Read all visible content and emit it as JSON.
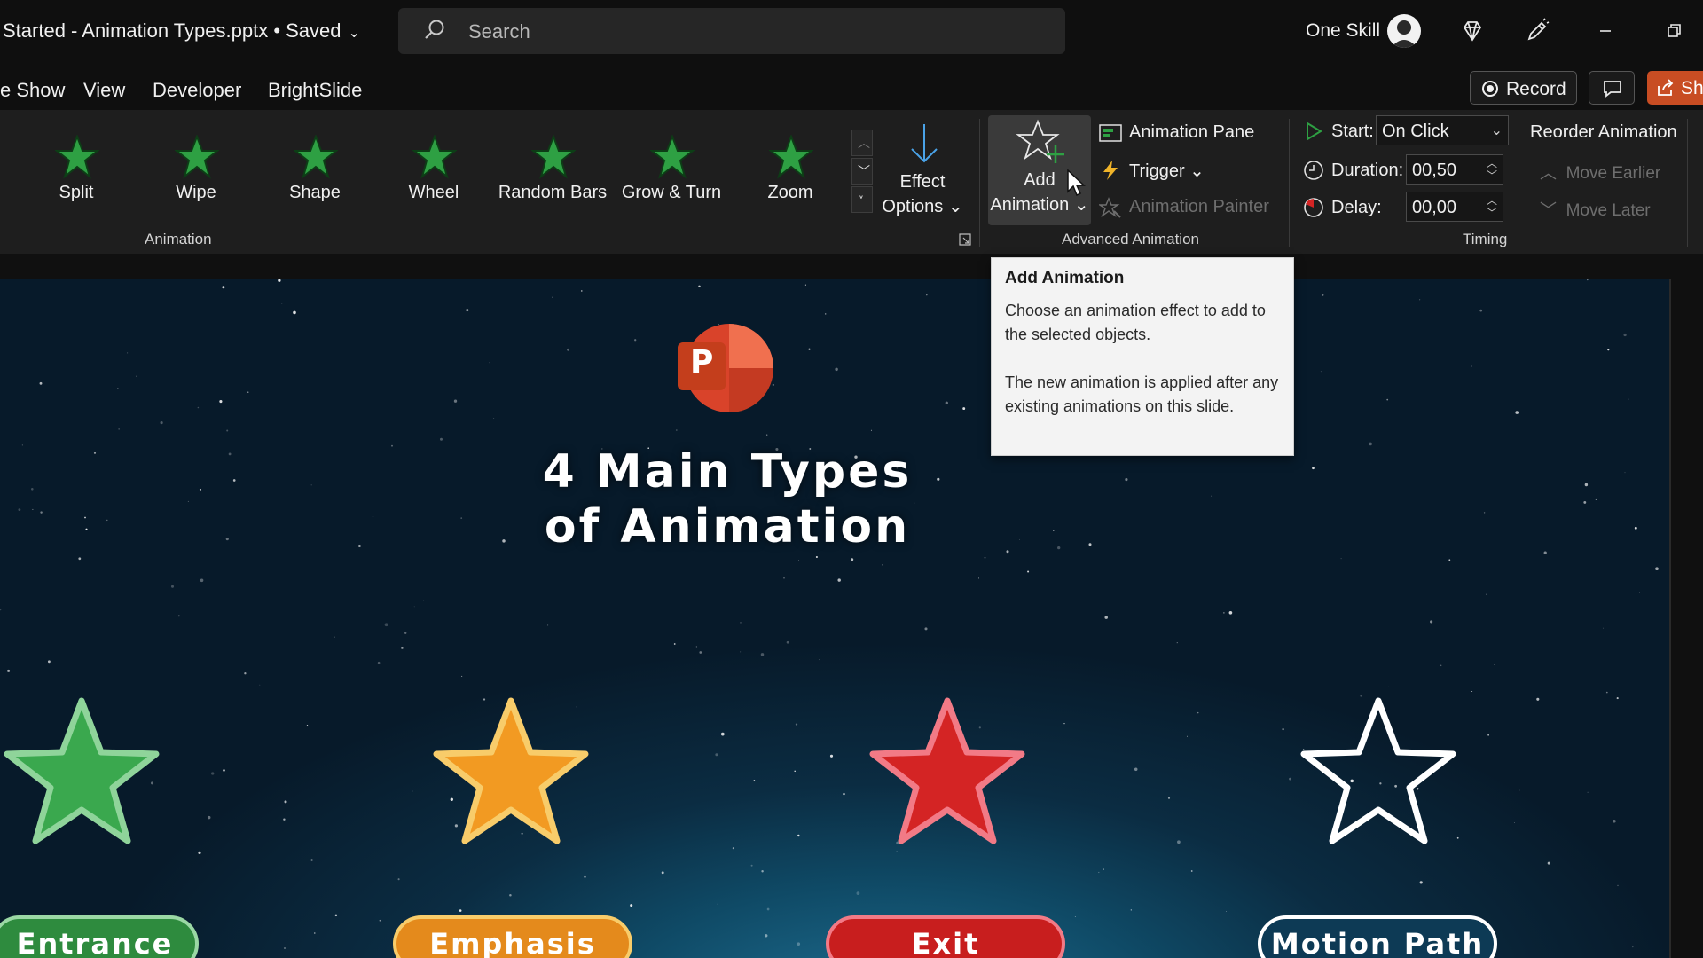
{
  "titlebar": {
    "doc_title": "Started - Animation Types.pptx • Saved",
    "search_placeholder": "Search",
    "user_name": "One Skill"
  },
  "menu": {
    "tabs": [
      "e Show",
      "View",
      "Developer",
      "BrightSlide"
    ],
    "record_label": "Record",
    "share_label": "Sh"
  },
  "ribbon": {
    "animation_gallery": [
      {
        "label": "Split"
      },
      {
        "label": "Wipe"
      },
      {
        "label": "Shape"
      },
      {
        "label": "Wheel"
      },
      {
        "label": "Random Bars"
      },
      {
        "label": "Grow & Turn"
      },
      {
        "label": "Zoom"
      }
    ],
    "effect_options": {
      "line1": "Effect",
      "line2": "Options"
    },
    "add_animation": {
      "line1": "Add",
      "line2": "Animation"
    },
    "advanced": {
      "animation_pane": "Animation Pane",
      "trigger": "Trigger",
      "animation_painter": "Animation Painter"
    },
    "timing": {
      "start_label": "Start:",
      "start_value": "On Click",
      "duration_label": "Duration:",
      "duration_value": "00,50",
      "delay_label": "Delay:",
      "delay_value": "00,00"
    },
    "reorder": {
      "title": "Reorder Animation",
      "move_earlier": "Move Earlier",
      "move_later": "Move Later"
    },
    "group_labels": {
      "animation": "Animation",
      "advanced_animation": "Advanced Animation",
      "timing": "Timing"
    }
  },
  "tooltip": {
    "title": "Add Animation",
    "para1": "Choose an animation effect to add to the selected objects.",
    "para2": "The new animation is applied after any existing animations on this slide."
  },
  "slide": {
    "logo_letter": "P",
    "title_line1": "4 Main Types",
    "title_line2": "of Animation",
    "types": [
      {
        "label": "Entrance",
        "color": "#2e8b3e",
        "star_color": "#3aa84e"
      },
      {
        "label": "Emphasis",
        "color": "#e48a1c",
        "star_color": "#f29a22"
      },
      {
        "label": "Exit",
        "color": "#c81e1e",
        "star_color": "#d42424"
      },
      {
        "label": "Motion Path",
        "color": "#0d3a55",
        "star_color": "none"
      }
    ]
  },
  "colors": {
    "ribbon_bg": "#1e1e1e",
    "titlebar_bg": "#0f0f0f",
    "share_accent": "#c84d23",
    "gallery_star": "#2ea043"
  }
}
